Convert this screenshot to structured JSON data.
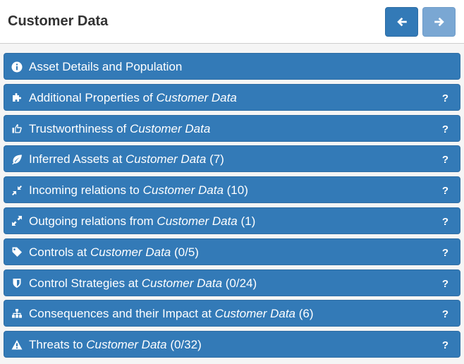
{
  "header": {
    "title": "Customer Data",
    "back_icon": "arrow-left-icon",
    "forward_icon": "arrow-right-icon"
  },
  "colors": {
    "accent": "#337ab7",
    "accent_disabled": "#7aa7d3",
    "text_dark": "#333333"
  },
  "sections": [
    {
      "icon": "info-circle-icon",
      "prefix": "Asset Details and Population",
      "asset": "",
      "suffix": "",
      "help": ""
    },
    {
      "icon": "puzzle-piece-icon",
      "prefix": "Additional Properties of ",
      "asset": "Customer Data",
      "suffix": "",
      "help": "?"
    },
    {
      "icon": "thumbs-up-icon",
      "prefix": "Trustworthiness of ",
      "asset": "Customer Data",
      "suffix": "",
      "help": "?"
    },
    {
      "icon": "leaf-icon",
      "prefix": "Inferred Assets at ",
      "asset": "Customer Data",
      "suffix": " (7)",
      "help": "?"
    },
    {
      "icon": "compress-arrows-icon",
      "prefix": "Incoming relations to ",
      "asset": "Customer Data",
      "suffix": " (10)",
      "help": "?"
    },
    {
      "icon": "expand-arrows-icon",
      "prefix": "Outgoing relations from ",
      "asset": "Customer Data",
      "suffix": " (1)",
      "help": "?"
    },
    {
      "icon": "tag-icon",
      "prefix": "Controls at ",
      "asset": "Customer Data",
      "suffix": " (0/5)",
      "help": "?"
    },
    {
      "icon": "shield-icon",
      "prefix": "Control Strategies at ",
      "asset": "Customer Data",
      "suffix": " (0/24)",
      "help": "?"
    },
    {
      "icon": "sitemap-icon",
      "prefix": "Consequences and their Impact at ",
      "asset": "Customer Data",
      "suffix": " (6)",
      "help": "?"
    },
    {
      "icon": "warning-triangle-icon",
      "prefix": "Threats to ",
      "asset": "Customer Data",
      "suffix": " (0/32)",
      "help": "?"
    }
  ]
}
